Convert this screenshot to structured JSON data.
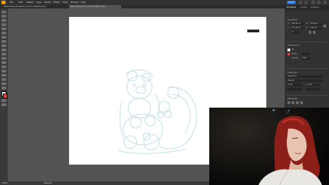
{
  "app": {
    "logo_text": "Ai"
  },
  "menu": [
    "File",
    "Edit",
    "Object",
    "Type",
    "Select",
    "Effect",
    "View",
    "Window",
    "Help"
  ],
  "header": {
    "share_label": "Share"
  },
  "tabs": [
    {
      "label": "Untitled-Character-Sketch.ai @ 50% (RGB/Preview)",
      "active": false
    },
    {
      "label": "Bear-Artboard.ai* @ 100% (RGB/Preview)",
      "active": true
    }
  ],
  "panel": {
    "tabs": [
      "Properties",
      "Layers",
      "Libraries"
    ],
    "transform": {
      "heading": "Transform",
      "x_label": "X:",
      "x_value": "364.452 px",
      "y_label": "Y:",
      "y_value": "127.561 px",
      "w_label": "W:",
      "w_value": "19.462 px",
      "h_label": "H:",
      "h_value": "5.849 px",
      "angle_value": "0°"
    },
    "appearance": {
      "heading": "Appearance",
      "fill_label": "Fill",
      "stroke_label": "Stroke",
      "opacity_label": "Opacity",
      "opacity_value": "100%"
    },
    "character": {
      "heading": "Character",
      "font_value": "Myriad Pro",
      "style_value": "Regular",
      "size_value": "12 pt",
      "leading_value": "14.4 pt"
    },
    "paragraph": {
      "heading": "Paragraph"
    }
  },
  "status": {
    "zoom": "100%",
    "tool": "Selection"
  },
  "colors": {
    "accent": "#1473e6",
    "sketch": "#a8d4e6",
    "logo": "#ff9a00"
  }
}
